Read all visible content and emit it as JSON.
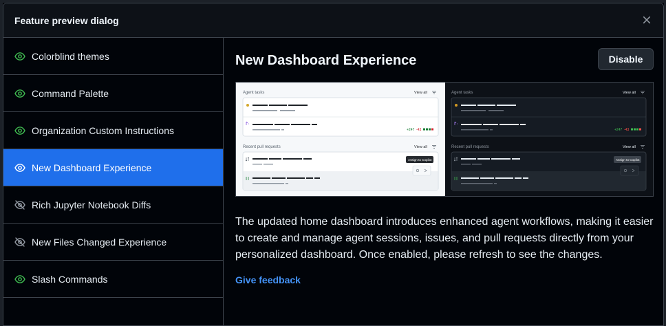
{
  "dialog": {
    "title": "Feature preview dialog",
    "close_icon": "x-icon"
  },
  "sidebar": {
    "items": [
      {
        "label": "Colorblind themes",
        "icon": "eye-icon",
        "enabled": true,
        "active": false
      },
      {
        "label": "Command Palette",
        "icon": "eye-icon",
        "enabled": true,
        "active": false
      },
      {
        "label": "Organization Custom Instructions",
        "icon": "eye-icon",
        "enabled": true,
        "active": false
      },
      {
        "label": "New Dashboard Experience",
        "icon": "eye-icon",
        "enabled": true,
        "active": true
      },
      {
        "label": "Rich Jupyter Notebook Diffs",
        "icon": "eye-closed-icon",
        "enabled": false,
        "active": false
      },
      {
        "label": "New Files Changed Experience",
        "icon": "eye-closed-icon",
        "enabled": false,
        "active": false
      },
      {
        "label": "Slash Commands",
        "icon": "eye-icon",
        "enabled": true,
        "active": false
      }
    ]
  },
  "main": {
    "title": "New Dashboard Experience",
    "disable_label": "Disable",
    "description": "The updated home dashboard introduces enhanced agent workflows, making it easier to create and manage agent sessions, issues, and pull requests directly from your personalized dashboard. Once enabled, please refresh to see the changes.",
    "feedback_label": "Give feedback"
  },
  "preview": {
    "agent_tasks_label": "Agent tasks",
    "view_all_label": "View all",
    "recent_prs_label": "Recent pull requests",
    "assign_tooltip": "Assign to Copilot",
    "additions": "+247",
    "deletions": "-43"
  },
  "colors": {
    "accent": "#1f6feb",
    "link": "#4493f8",
    "eye_enabled": "#3fb950",
    "eye_disabled": "#9198a1",
    "border": "#3d444d"
  }
}
